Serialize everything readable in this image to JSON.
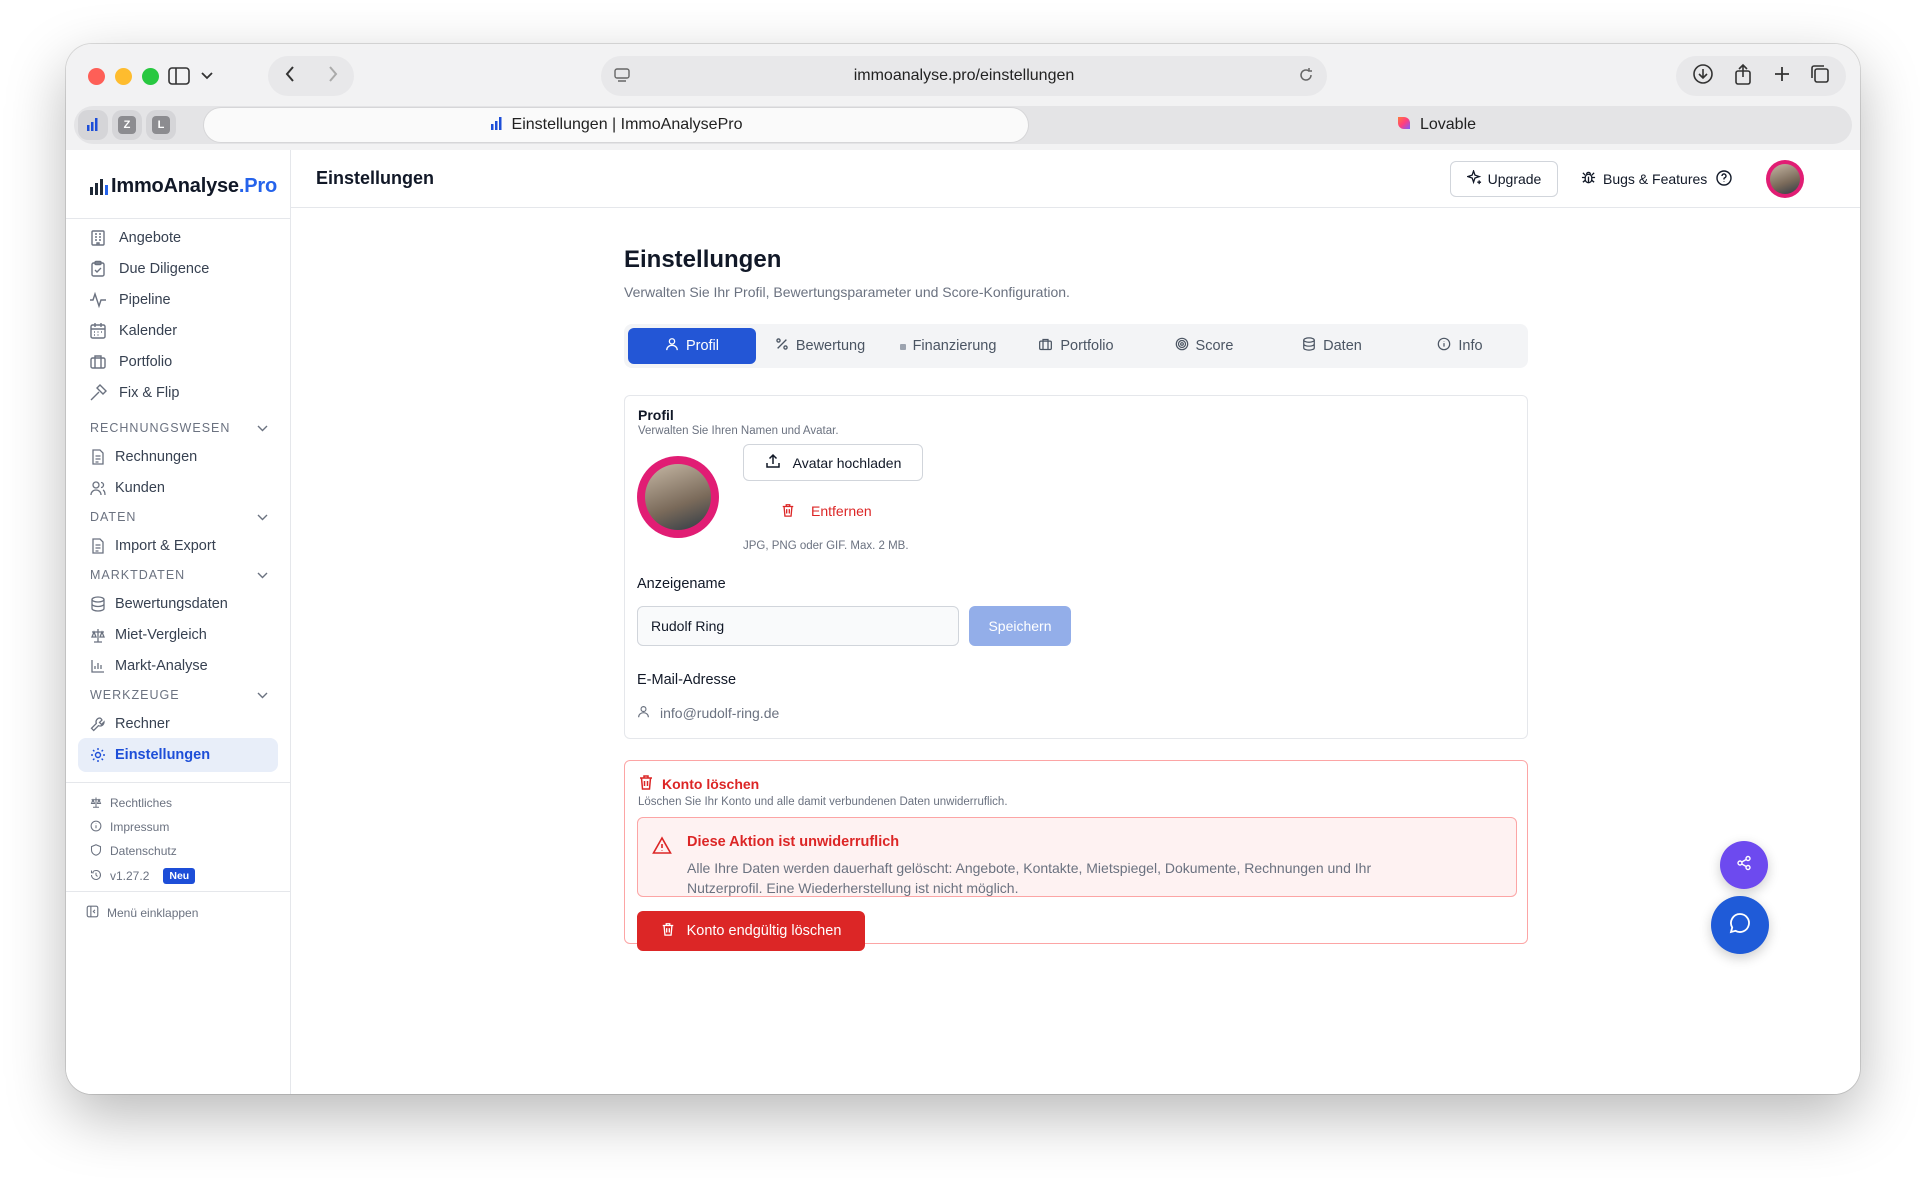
{
  "browser": {
    "url": "immoanalyse.pro/einstellungen",
    "active_tab_title": "Einstellungen | ImmoAnalysePro",
    "other_tab_title": "Lovable",
    "pinned_tabs": [
      "Z",
      "L"
    ]
  },
  "app": {
    "logo_main": "ImmoAnalyse",
    "logo_suffix": ".Pro",
    "top_title": "Einstellungen",
    "upgrade_label": "Upgrade",
    "bugs_label": "Bugs & Features"
  },
  "sidebar": {
    "main_items": [
      {
        "label": "Angebote",
        "icon": "building-icon"
      },
      {
        "label": "Due Diligence",
        "icon": "clipboard-check-icon"
      },
      {
        "label": "Pipeline",
        "icon": "activity-icon"
      },
      {
        "label": "Kalender",
        "icon": "calendar-icon"
      },
      {
        "label": "Portfolio",
        "icon": "briefcase-icon"
      },
      {
        "label": "Fix & Flip",
        "icon": "hammer-icon"
      }
    ],
    "sections": {
      "rechnungswesen": {
        "title": "RECHNUNGSWESEN",
        "items": [
          "Rechnungen",
          "Kunden"
        ]
      },
      "daten": {
        "title": "DATEN",
        "items": [
          "Import & Export"
        ]
      },
      "marktdaten": {
        "title": "MARKTDATEN",
        "items": [
          "Bewertungsdaten",
          "Miet-Vergleich",
          "Markt-Analyse"
        ]
      },
      "werkzeuge": {
        "title": "WERKZEUGE",
        "items": [
          "Rechner",
          "Einstellungen"
        ]
      }
    },
    "footer": {
      "rechtliches": "Rechtliches",
      "impressum": "Impressum",
      "datenschutz": "Datenschutz",
      "version": "v1.27.2",
      "version_badge": "Neu",
      "collapse": "Menü einklappen"
    }
  },
  "page": {
    "title": "Einstellungen",
    "subtitle": "Verwalten Sie Ihr Profil, Bewertungsparameter und Score-Konfiguration.",
    "tabs": [
      "Profil",
      "Bewertung",
      "Finanzierung",
      "Portfolio",
      "Score",
      "Daten",
      "Info"
    ],
    "active_tab": "Profil"
  },
  "profile_card": {
    "title": "Profil",
    "description": "Verwalten Sie Ihren Namen und Avatar.",
    "upload_label": "Avatar hochladen",
    "remove_label": "Entfernen",
    "hint": "JPG, PNG oder GIF. Max. 2 MB.",
    "display_name_label": "Anzeigename",
    "display_name_value": "Rudolf Ring",
    "save_label": "Speichern",
    "email_label": "E-Mail-Adresse",
    "email_value": "info@rudolf-ring.de"
  },
  "danger_card": {
    "title": "Konto löschen",
    "description": "Löschen Sie Ihr Konto und alle damit verbundenen Daten unwiderruflich.",
    "alert_title": "Diese Aktion ist unwiderruflich",
    "alert_text": "Alle Ihre Daten werden dauerhaft gelöscht: Angebote, Kontakte, Mietspiegel, Dokumente, Rechnungen und Ihr Nutzerprofil. Eine Wiederherstellung ist nicht möglich.",
    "delete_label": "Konto endgültig löschen"
  },
  "colors": {
    "accent": "#2356d6",
    "danger": "#dc2626",
    "avatar_ring": "#e11d74",
    "share_fab": "#6d4aef",
    "chat_fab": "#1f5bd8"
  }
}
